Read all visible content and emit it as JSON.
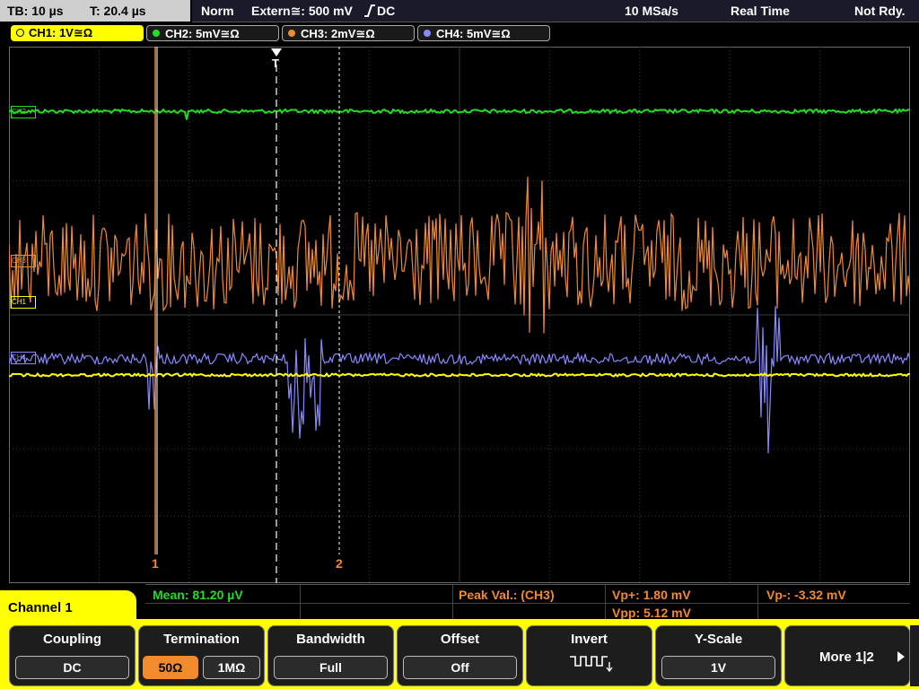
{
  "status": {
    "timebase": "TB: 10 µs",
    "trigger_time": "T: 20.4 µs",
    "mode": "Norm",
    "trigger_source": "Extern≅: 500 mV",
    "slope_icon": "rising-edge-icon",
    "coupling_suffix": "DC",
    "sample_rate": "10 MSa/s",
    "acquisition": "Real Time",
    "state": "Not Rdy."
  },
  "channels": [
    {
      "label": "CH1: 1V≅Ω",
      "color": "#ffff00"
    },
    {
      "label": "CH2: 5mV≅Ω",
      "color": "#22dd22"
    },
    {
      "label": "CH3: 2mV≅Ω",
      "color": "#f28a2e"
    },
    {
      "label": "CH4: 5mV≅Ω",
      "color": "#8888ff"
    }
  ],
  "markers": {
    "trigger": "T",
    "cursor1": "1",
    "cursor2": "2",
    "ch2": "CH2",
    "ch3": "CH3",
    "ch4": "CH4",
    "ch1": "CH1"
  },
  "measurements": {
    "mean": "Mean: 81.20 µV",
    "peak_label": "Peak Val.:  (CH3)",
    "vp_plus": "Vp+: 1.80 mV",
    "vp_minus": "Vp-: -3.32 mV",
    "vpp": "Vpp: 5.12 mV"
  },
  "menu": {
    "title": "Channel 1",
    "coupling": {
      "title": "Coupling",
      "value": "DC"
    },
    "termination": {
      "title": "Termination",
      "opt1": "50Ω",
      "opt2": "1MΩ",
      "selected": "50Ω"
    },
    "bandwidth": {
      "title": "Bandwidth",
      "value": "Full"
    },
    "offset": {
      "title": "Offset",
      "value": "Off"
    },
    "invert": {
      "title": "Invert",
      "icon": "inverted-square-wave-icon"
    },
    "yscale": {
      "title": "Y-Scale",
      "value": "1V"
    },
    "more": {
      "label": "More 1|2",
      "icon": "right-arrow-icon"
    }
  }
}
